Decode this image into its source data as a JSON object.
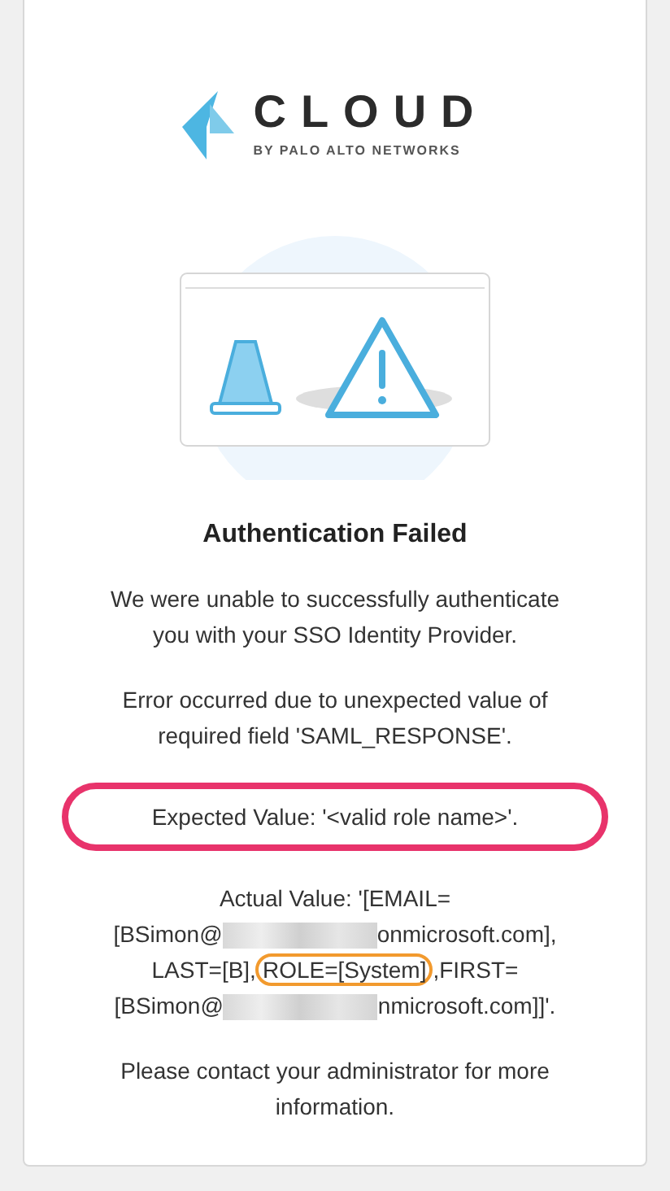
{
  "logo": {
    "wordmark": "CLOUD",
    "tagline": "BY PALO ALTO NETWORKS"
  },
  "title": "Authentication Failed",
  "messages": [
    {
      "lines": [
        [
          {
            "kind": "plain",
            "text": "We were unable to successfully authenticate you with your SSO Identity Provider."
          }
        ]
      ]
    },
    {
      "lines": [
        [
          {
            "kind": "plain",
            "text": "Error occurred due to unexpected value of required field 'SAML_RESPONSE'."
          }
        ]
      ]
    },
    {
      "color": "#e8336b",
      "lines": [
        [
          {
            "kind": "plain",
            "text": "Expected Value: '<valid role name>'."
          }
        ]
      ]
    },
    {
      "lines": [
        [
          {
            "kind": "plain",
            "text": "Actual Value: '[EMAIL="
          }
        ],
        [
          {
            "kind": "plain",
            "text": "[BSimon@"
          },
          {
            "kind": "redacted"
          },
          {
            "kind": "plain",
            "text": "onmicrosoft.com],"
          }
        ],
        [
          {
            "kind": "plain",
            "text": "LAST=[B],"
          },
          {
            "kind": "circled",
            "text": "ROLE=[System]",
            "color": "#f29a2e"
          },
          {
            "kind": "plain",
            "text": ",FIRST="
          }
        ],
        [
          {
            "kind": "plain",
            "text": "[BSimon@"
          },
          {
            "kind": "redacted"
          },
          {
            "kind": "plain",
            "text": "nmicrosoft.com]]'."
          }
        ]
      ]
    },
    {
      "lines": [
        [
          {
            "kind": "plain",
            "text": "Please contact your administrator for more information."
          }
        ]
      ]
    }
  ]
}
